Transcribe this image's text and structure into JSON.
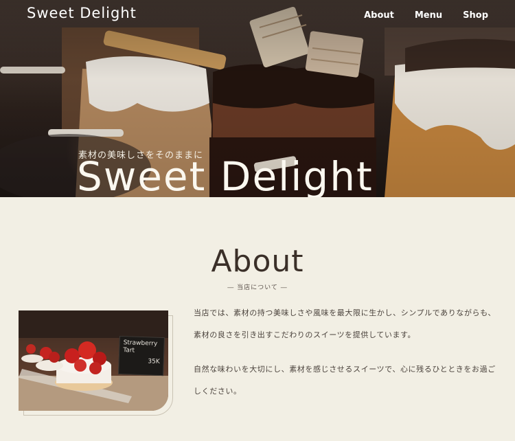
{
  "header": {
    "logo": "Sweet Delight",
    "nav": [
      {
        "label": "About"
      },
      {
        "label": "Menu"
      },
      {
        "label": "Shop"
      }
    ]
  },
  "hero": {
    "tagline": "素材の美味しさをそのままに",
    "title": "Sweet Delight"
  },
  "about": {
    "title": "About",
    "subtitle": "― 当店について ―",
    "photo_sign": {
      "line1": "Strawberry",
      "line2": "Tart",
      "price": "35K"
    },
    "paragraphs": [
      "当店では、素材の持つ美味しさや風味を最大限に生かし、シンプルでありながらも、素材の良さを引き出すこだわりのスイーツを提供しています。",
      "自然な味わいを大切にし、素材を感じさせるスイーツで、心に残るひとときをお過ごしください。"
    ]
  },
  "colors": {
    "background": "#f2efe4",
    "text": "#3a3430",
    "hero_text": "#ffffff"
  }
}
